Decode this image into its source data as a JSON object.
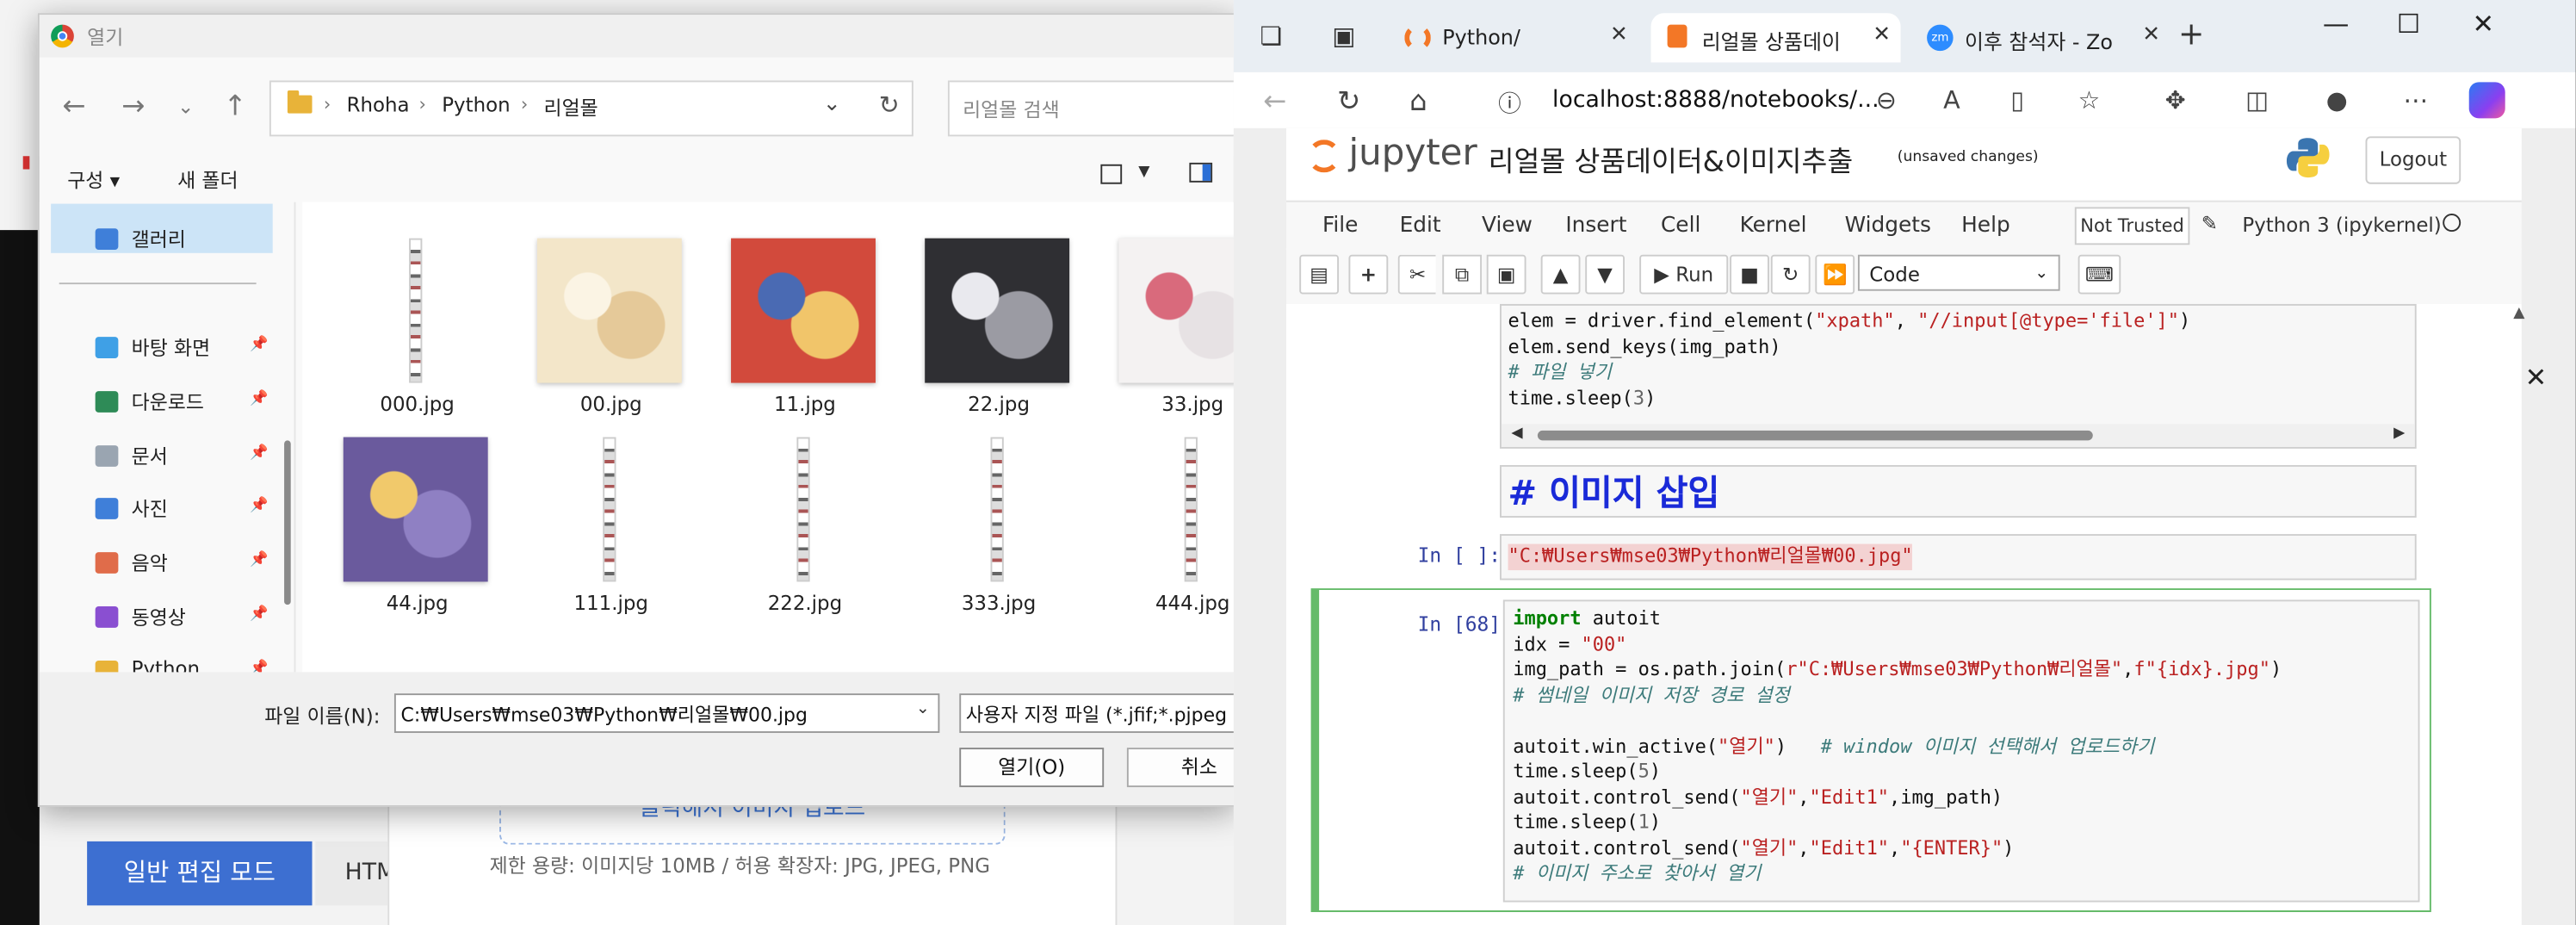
{
  "background_page": {
    "upload_text": "클릭해서 이미지 업로드",
    "limit_text": "제한 용량: 이미지당 10MB / 허용 확장자: JPG, JPEG, PNG",
    "mode_button": "일반 편집 모드",
    "html_tab": "HTM"
  },
  "dialog": {
    "title": "열기",
    "breadcrumb": [
      "Rhoha",
      "Python",
      "리얼몰"
    ],
    "search_placeholder": "리얼몰 검색",
    "toolbar": {
      "organize": "구성 ▾",
      "new_folder": "새 폴더"
    },
    "sidebar": [
      {
        "label": "갤러리",
        "icon": "gallery-icon",
        "color": "#3f7fd9"
      },
      {
        "label": "바탕 화면",
        "icon": "desktop-icon",
        "color": "#3fa0e6"
      },
      {
        "label": "다운로드",
        "icon": "download-icon",
        "color": "#2e8b57"
      },
      {
        "label": "문서",
        "icon": "documents-icon",
        "color": "#9aa5b1"
      },
      {
        "label": "사진",
        "icon": "pictures-icon",
        "color": "#3f7fd9"
      },
      {
        "label": "음악",
        "icon": "music-icon",
        "color": "#e06c4a"
      },
      {
        "label": "동영상",
        "icon": "videos-icon",
        "color": "#8a4fd1"
      },
      {
        "label": "Python",
        "icon": "folder-icon",
        "color": "#e8b339"
      }
    ],
    "files": [
      {
        "name": "000.jpg",
        "kind": "strip"
      },
      {
        "name": "00.jpg",
        "kind": "photo",
        "colors": [
          "#f3e6c9",
          "#e5c999",
          "#fbf4e4"
        ]
      },
      {
        "name": "11.jpg",
        "kind": "photo",
        "colors": [
          "#d24a3c",
          "#f1c56a",
          "#4a6ab3"
        ]
      },
      {
        "name": "22.jpg",
        "kind": "photo",
        "colors": [
          "#2f2f33",
          "#9b9ba3",
          "#e9e9ee"
        ]
      },
      {
        "name": "33.jpg",
        "kind": "photo",
        "colors": [
          "#f4f2f2",
          "#e7e2e4",
          "#d96a7c"
        ]
      },
      {
        "name": "44.jpg",
        "kind": "photo",
        "colors": [
          "#6a5a9d",
          "#8f80c3",
          "#f1c96b"
        ]
      },
      {
        "name": "111.jpg",
        "kind": "strip"
      },
      {
        "name": "222.jpg",
        "kind": "strip"
      },
      {
        "name": "333.jpg",
        "kind": "strip"
      },
      {
        "name": "444.jpg",
        "kind": "strip"
      }
    ],
    "filename_label": "파일 이름(N):",
    "filename_value": "C:₩Users₩mse03₩Python₩리얼몰₩00.jpg",
    "filetype_value": "사용자 지정 파일 (*.jfif;*.pjpeg",
    "open_button": "열기(O)",
    "cancel_button": "취소"
  },
  "browser": {
    "tabs": [
      {
        "label": "Python/",
        "icon_color": "#f37726"
      },
      {
        "label": "리얼몰 상품데이",
        "icon_color": "#f37726"
      },
      {
        "label": "이후 참석자 - Zo",
        "icon_color": "#2d8cff"
      }
    ],
    "url": "localhost:8888/notebooks/...",
    "jupyter": {
      "logo_text": "jupyter",
      "notebook_name": "리얼몰 상품데이터&이미지추출",
      "unsaved": "(unsaved changes)",
      "logout": "Logout",
      "menu": [
        "File",
        "Edit",
        "View",
        "Insert",
        "Cell",
        "Kernel",
        "Widgets",
        "Help"
      ],
      "not_trusted": "Not Trusted",
      "kernel": "Python 3 (ipykernel)",
      "run_label": "Run",
      "cell_type": "Code",
      "cell1_lines": [
        "elem = driver.find_element(\"xpath\", \"//input[@type='file']\")",
        "elem.send_keys(img_path)",
        "# 파일 넣기",
        "time.sleep(3)"
      ],
      "heading": "# 이미지 삽입",
      "cell3_prompt": "In [ ]:",
      "cell3_code": "\"C:₩Users₩mse03₩Python₩리얼몰₩00.jpg\"",
      "cell4_prompt": "In [68]:",
      "cell4_lines": [
        "import autoit",
        "idx = \"00\"",
        "img_path = os.path.join(r\"C:₩Users₩mse03₩Python₩리얼몰\",f\"{idx}.jpg\")",
        "# 썸네일 이미지 저장 경로 설정",
        "",
        "autoit.win_active(\"열기\")   # window 이미지 선택해서 업로드하기",
        "time.sleep(5)",
        "autoit.control_send(\"열기\",\"Edit1\",img_path)",
        "time.sleep(1)",
        "autoit.control_send(\"열기\",\"Edit1\",\"{ENTER}\")",
        "# 이미지 주소로 찾아서 열기"
      ]
    }
  }
}
